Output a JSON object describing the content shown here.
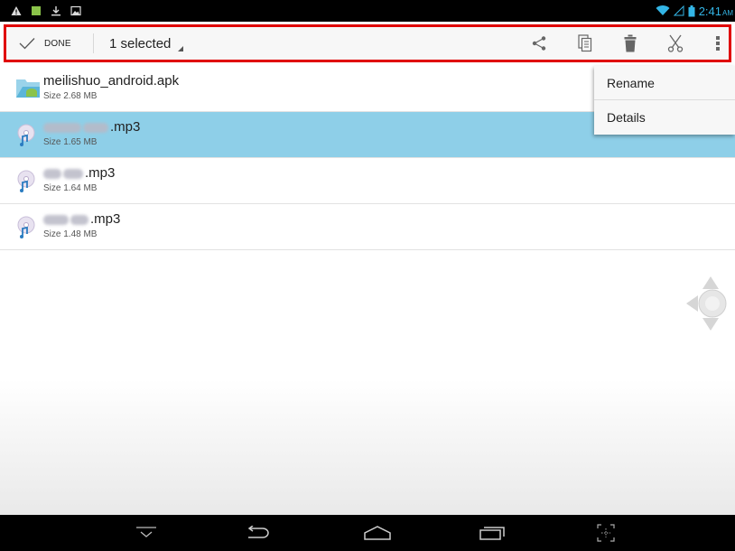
{
  "status_bar": {
    "time": "2:41",
    "ampm": "AM",
    "left_icons": [
      "warning-icon",
      "app-notification-icon",
      "download-icon",
      "image-icon"
    ],
    "right_icons": [
      "wifi-icon",
      "signal-icon",
      "battery-icon"
    ]
  },
  "action_bar": {
    "done_label": "DONE",
    "selection_label": "1 selected",
    "actions": [
      "share-icon",
      "copy-icon",
      "delete-icon",
      "cut-icon",
      "overflow-menu-icon"
    ]
  },
  "files": [
    {
      "name": "meilishuo_android.apk",
      "size": "Size 2.68 MB",
      "type": "apk",
      "selected": false
    },
    {
      "name_suffix": ".mp3",
      "size": "Size 1.65 MB",
      "type": "audio",
      "selected": true
    },
    {
      "name_suffix": ".mp3",
      "size": "Size 1.64 MB",
      "type": "audio",
      "selected": false
    },
    {
      "name_suffix": ".mp3",
      "size": "Size 1.48 MB",
      "type": "audio",
      "selected": false
    }
  ],
  "popup_menu": {
    "items": [
      "Rename",
      "Details"
    ]
  },
  "nav_bar": {
    "buttons": [
      "hide-keyboard-icon",
      "back-icon",
      "home-icon",
      "recent-apps-icon",
      "screenshot-icon"
    ]
  },
  "colors": {
    "selected_row": "#8ecfe8",
    "highlight_border": "#e00000",
    "status_accent": "#33b5e5"
  }
}
